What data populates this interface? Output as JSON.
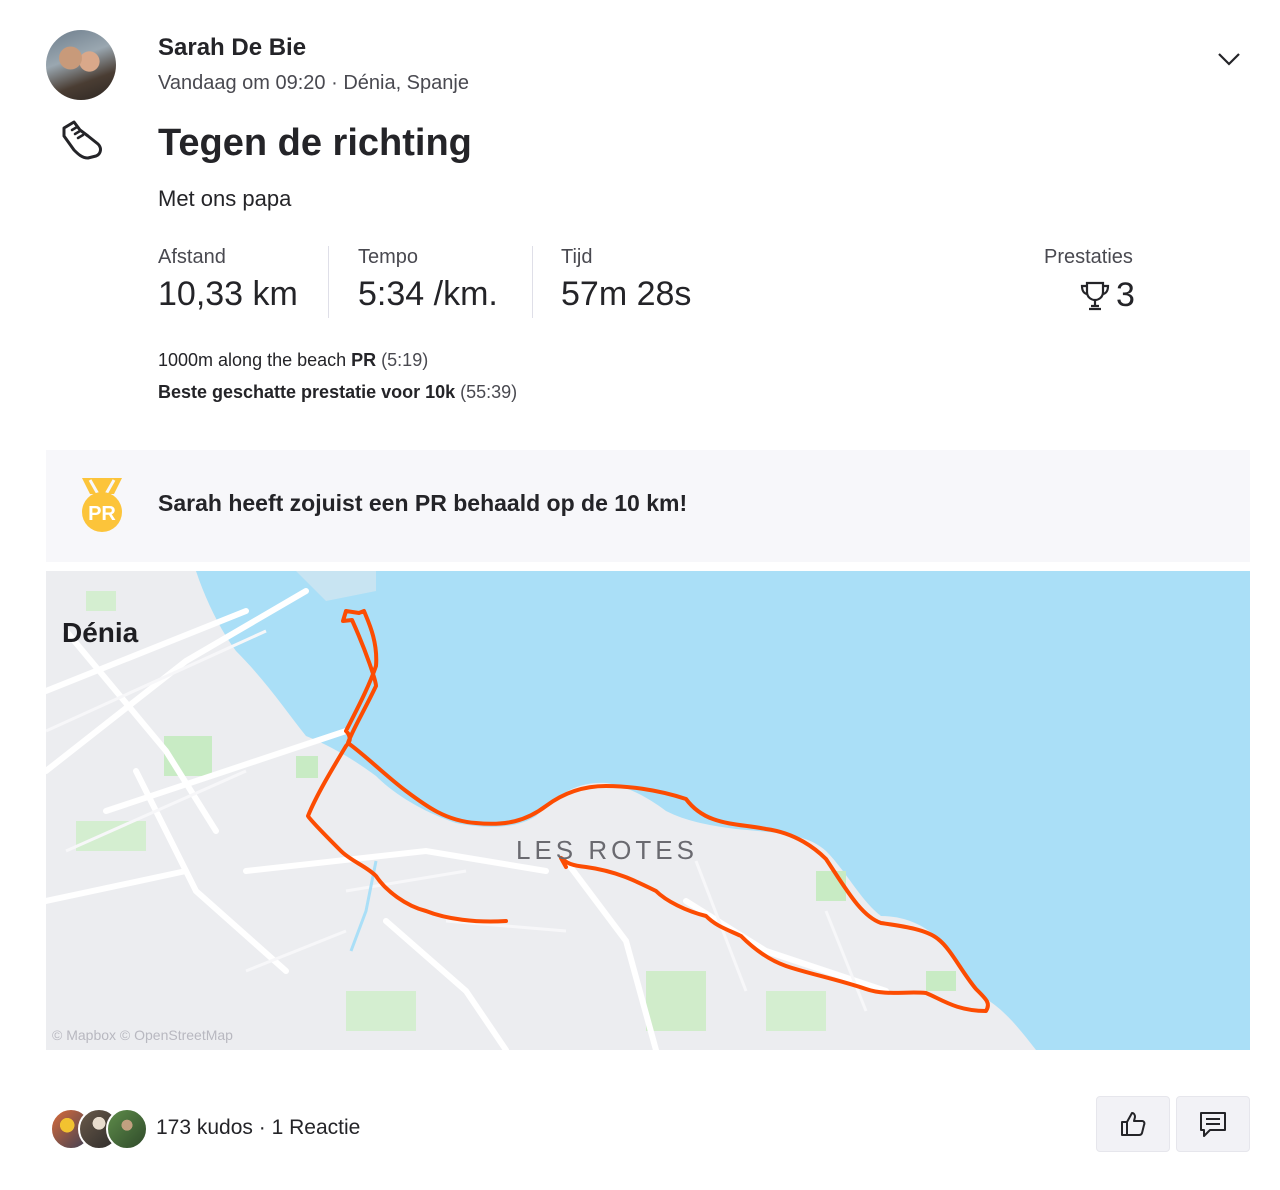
{
  "user": {
    "name": "Sarah De Bie",
    "meta": "Vandaag om 09:20 · Dénia, Spanje"
  },
  "activity": {
    "sport_icon": "running-shoe-icon",
    "title": "Tegen de richting",
    "description": "Met ons papa"
  },
  "stats": [
    {
      "label": "Afstand",
      "value": "10,33 km"
    },
    {
      "label": "Tempo",
      "value": "5:34 /km."
    },
    {
      "label": "Tijd",
      "value": "57m 28s"
    }
  ],
  "achievements": {
    "label": "Prestaties",
    "count": "3",
    "icon": "trophy-icon"
  },
  "highlights": [
    {
      "name": "1000m along the beach",
      "badge": "PR",
      "time": "(5:19)"
    },
    {
      "name": "Beste geschatte prestatie voor 10k",
      "time": "(55:39)"
    }
  ],
  "pr_banner": {
    "medal_label": "PR",
    "text": "Sarah heeft zojuist een PR behaald op de 10 km!"
  },
  "map": {
    "city_label": "Dénia",
    "area_label": "LES ROTES",
    "credit": "© Mapbox © OpenStreetMap",
    "route_color": "#fc4c02",
    "water_color": "#aadff7"
  },
  "footer": {
    "kudos": "173 kudos",
    "separator": " · ",
    "comments": "1 Reactie"
  }
}
